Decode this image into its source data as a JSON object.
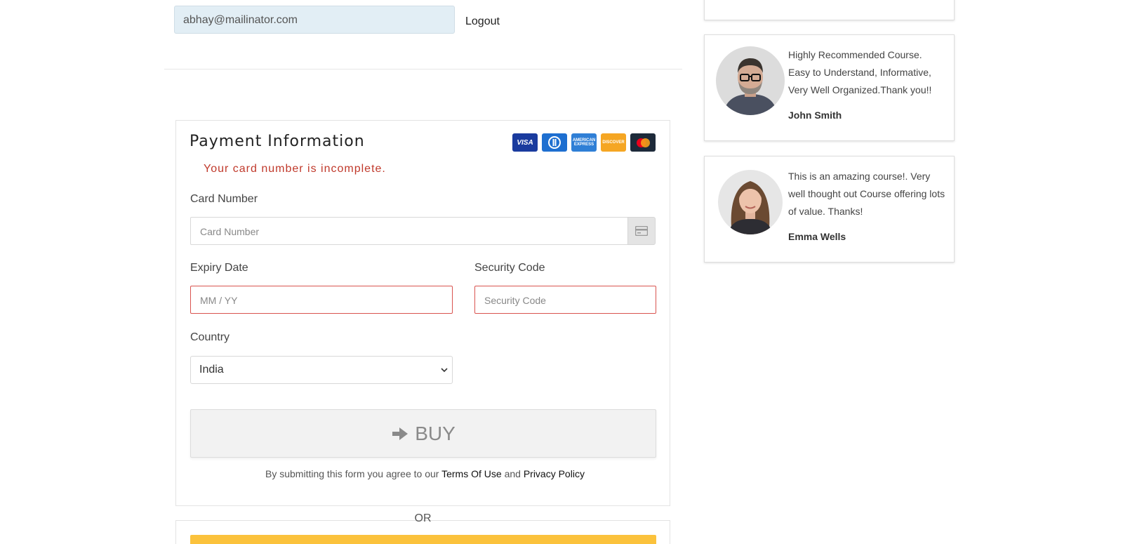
{
  "header": {
    "email": "abhay@mailinator.com",
    "logout": "Logout"
  },
  "payment": {
    "title": "Payment Information",
    "error": "Your card number is incomplete.",
    "card_icons": [
      "visa-icon",
      "diners-club-icon",
      "american-express-icon",
      "discover-icon",
      "mastercard-icon"
    ],
    "card_labels": {
      "visa": "VISA",
      "amex": "AMERICAN EXPRESS",
      "discover": "DISCOVER"
    },
    "card_number": {
      "label": "Card Number",
      "placeholder": "Card Number"
    },
    "expiry": {
      "label": "Expiry Date",
      "placeholder": "MM / YY"
    },
    "security": {
      "label": "Security Code",
      "placeholder": "Security Code"
    },
    "country": {
      "label": "Country",
      "value": "India"
    },
    "buy_label": "BUY",
    "terms": {
      "prefix": "By submitting this form you agree to our",
      "terms_link": "Terms Of Use",
      "and": "and",
      "privacy_link": "Privacy Policy"
    },
    "or_label": "OR"
  },
  "testimonials": [
    {
      "text": "Highly Recommended Course. Easy to Understand, Informative, Very Well Organized.Thank you!!",
      "name": "John Smith"
    },
    {
      "text": "This is an amazing course!. Very well thought out Course offering lots of value. Thanks!",
      "name": "Emma Wells"
    }
  ],
  "colors": {
    "error": "#c0392b",
    "email_bg": "#e2eef5",
    "buy_button": "#f2f2f2",
    "paypal_button": "#fbc23c"
  }
}
